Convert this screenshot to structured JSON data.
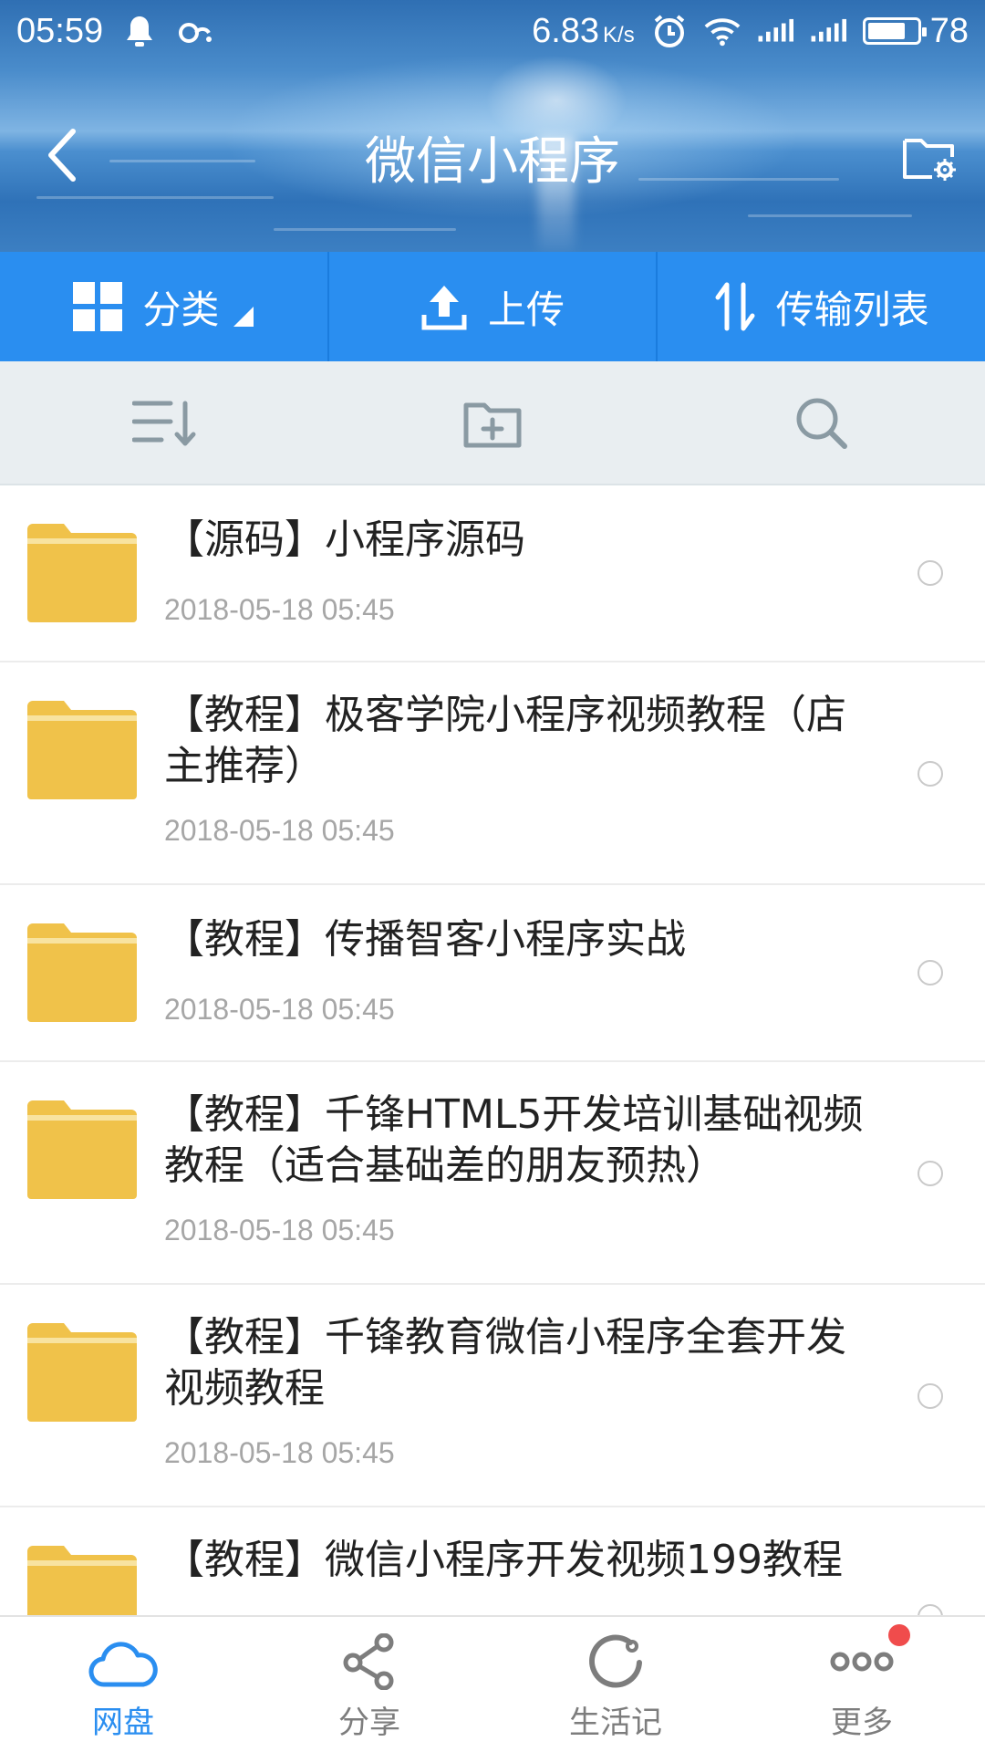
{
  "status_bar": {
    "time": "05:59",
    "speed_value": "6.83",
    "speed_unit": "K/s",
    "battery": "78"
  },
  "header": {
    "title": "微信小程序"
  },
  "actions": {
    "category": "分类",
    "upload": "上传",
    "transfer_list": "传输列表"
  },
  "files": [
    {
      "name": "【源码】小程序源码",
      "date": "2018-05-18  05:45"
    },
    {
      "name": "【教程】极客学院小程序视频教程（店主推荐）",
      "date": "2018-05-18  05:45"
    },
    {
      "name": "【教程】传播智客小程序实战",
      "date": "2018-05-18  05:45"
    },
    {
      "name": "【教程】千锋HTML5开发培训基础视频教程（适合基础差的朋友预热）",
      "date": "2018-05-18  05:45"
    },
    {
      "name": "【教程】千锋教育微信小程序全套开发视频教程",
      "date": "2018-05-18  05:45"
    },
    {
      "name": "【教程】微信小程序开发视频199教程",
      "date": ""
    }
  ],
  "bottom_nav": {
    "items": [
      {
        "label": "网盘",
        "icon": "cloud-icon",
        "active": true
      },
      {
        "label": "分享",
        "icon": "share-icon",
        "active": false
      },
      {
        "label": "生活记",
        "icon": "refresh-circle-icon",
        "active": false
      },
      {
        "label": "更多",
        "icon": "more-dots-icon",
        "active": false
      }
    ]
  },
  "colors": {
    "accent": "#2a8ef0",
    "folder": "#f0c24a",
    "badge": "#f04c4c"
  }
}
